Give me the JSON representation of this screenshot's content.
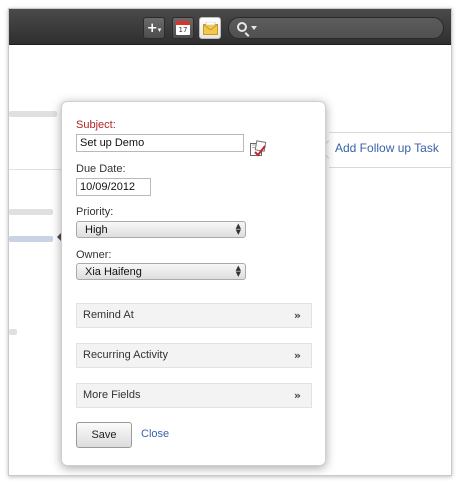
{
  "toolbar": {
    "create_icon": "plus-with-caret-icon",
    "calendar_icon": "calendar-icon",
    "calendar_day": "17",
    "mail_icon": "envelope-icon",
    "search_icon": "magnifier-with-caret-icon"
  },
  "side": {
    "add_follow_up": "Add Follow up Task"
  },
  "form": {
    "subject_label": "Subject:",
    "subject_value": "Set up Demo",
    "subject_icon": "task-checkbox-icon",
    "due_label": "Due Date:",
    "due_value": "10/09/2012",
    "priority_label": "Priority:",
    "priority_value": "High",
    "owner_label": "Owner:",
    "owner_value": "Xia Haifeng",
    "sections": {
      "remind": "Remind At",
      "recurring": "Recurring Activity",
      "more": "More Fields"
    },
    "expand_glyph": "»",
    "save": "Save",
    "close": "Close"
  },
  "colors": {
    "required_label": "#b22222",
    "link": "#3a62a8",
    "topbar": "#3a3a3a"
  }
}
